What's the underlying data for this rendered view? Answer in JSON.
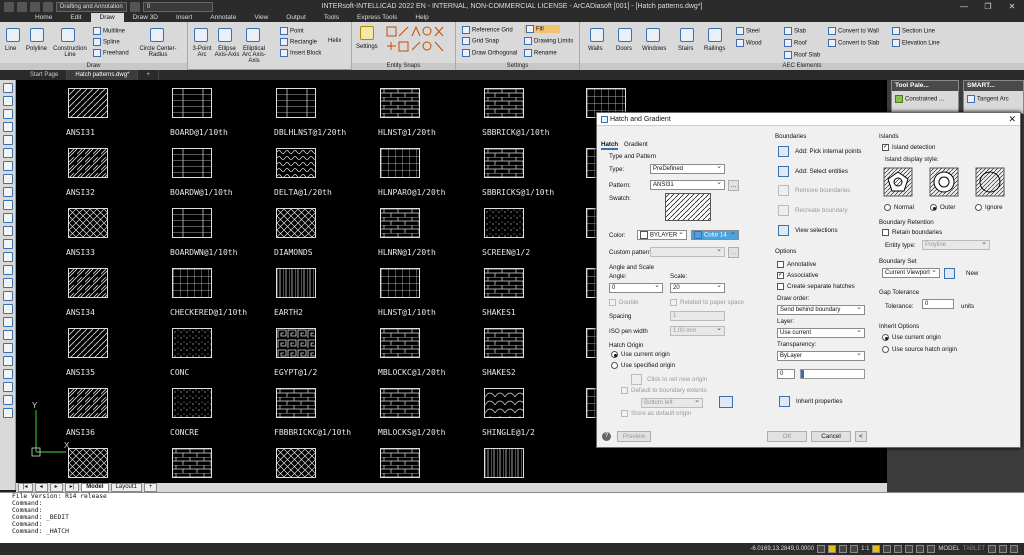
{
  "window": {
    "title": "INTERsoft-INTELLICAD 2022 EN - INTERNAL, NON-COMMERCIAL LICENSE - ArCADiasoft [001] - [Hatch patterns.dwg*]",
    "workspace": "Drafting and Annotation",
    "layer": "0",
    "controls": [
      "—",
      "❐",
      "✕"
    ]
  },
  "menu": [
    "Home",
    "Edit",
    "Draw",
    "Draw 3D",
    "Insert",
    "Annotate",
    "View",
    "Output",
    "Tools",
    "Express Tools",
    "Help"
  ],
  "menu_active": "Draw",
  "ribbon": {
    "draw": {
      "label": "Draw",
      "items": [
        "Line",
        "Polyline",
        "Construction Line",
        "Multiline",
        "Spline",
        "Freehand",
        "Circle Center-Radius",
        "3-Point Arc",
        "Ellipse Axis-Axis",
        "Elliptical Arc Axis-Axis",
        "Point",
        "Rectangle",
        "Helix",
        "Insert Block"
      ]
    },
    "snaps": {
      "label": "Entity Snaps",
      "items": [
        "Settings"
      ]
    },
    "settings": {
      "label": "Settings",
      "items": [
        "Reference Grid",
        "Grid Snap",
        "Draw Orthogonal",
        "Fill",
        "Drawing Limits",
        "Rename"
      ]
    },
    "aec": {
      "label": "AEC Elements",
      "items": [
        "Walls",
        "Doors",
        "Windows",
        "Stairs",
        "Railings",
        "Steel",
        "Wood",
        "Slab",
        "Roof",
        "Roof Slab",
        "Convert to Wall",
        "Convert to Slab",
        "Section Line",
        "Elevation Line"
      ]
    }
  },
  "doc_tabs": [
    "Start Page",
    "Hatch patterns.dwg*",
    "+"
  ],
  "hatch_labels": [
    [
      "ANSI31",
      "BOARD@1/10th",
      "DBLHLNST@1/20th",
      "HLNST@1/20th",
      "SBBRICK@1/10th"
    ],
    [
      "ANSI32",
      "BOARDW@1/10th",
      "DELTA@1/20th",
      "HLNPARO@1/20th",
      "SBBRICKS@1/10th"
    ],
    [
      "ANSI33",
      "BOARDWN@1/10th",
      "DIAMONDS",
      "HLNRN@1/20th",
      "SCREEN@1/2"
    ],
    [
      "ANSI34",
      "CHECKERED@1/10th",
      "EARTH2",
      "HLNST@1/10th",
      "SHAKES1"
    ],
    [
      "ANSI35",
      "CONC",
      "EGYPT@1/2",
      "MBLOCKC@1/20th",
      "SHAKES2"
    ],
    [
      "ANSI36",
      "CONCRE",
      "FBBBRICKC@1/10th",
      "MBLOCKS@1/20th",
      "SHINGLE@1/2"
    ]
  ],
  "model_tabs": [
    "Model",
    "Layout1",
    "+"
  ],
  "palettes": [
    {
      "title": "Tool Pale...",
      "item": "Constrained ..."
    },
    {
      "title": "SMART...",
      "item": "Tangent Arc"
    }
  ],
  "dialog": {
    "title": "Hatch and Gradient",
    "tabs": [
      "Hatch",
      "Gradient"
    ],
    "type_and_pattern": {
      "heading": "Type and Pattern",
      "type_label": "Type:",
      "type_value": "PreDefined",
      "pattern_label": "Pattern:",
      "pattern_value": "ANSI31",
      "swatch_label": "Swatch:",
      "color_label": "Color:",
      "color_value": "BYLAYER",
      "color2_value": "Color 14",
      "custom_label": "Custom pattern:"
    },
    "angle_and_scale": {
      "heading": "Angle and Scale",
      "angle_label": "Angle:",
      "angle_value": "0",
      "scale_label": "Scale:",
      "scale_value": "20",
      "double_label": "Double",
      "relative_label": "Related to paper space",
      "spacing_label": "Spacing",
      "spacing_value": "1",
      "iso_label": "ISO pen width",
      "iso_value": "1.00 mm"
    },
    "hatch_origin": {
      "heading": "Hatch Origin",
      "current": "Use current origin",
      "specified": "Use specified origin",
      "click_set": "Click to set new origin",
      "default_ext": "Default to boundary extents",
      "position": "Bottom left",
      "store": "Store as default origin"
    },
    "boundaries": {
      "heading": "Boundaries",
      "add_pick": "Add: Pick internal points",
      "add_select": "Add: Select entities",
      "remove": "Remove boundaries",
      "recreate": "Recreate boundary",
      "view": "View selections"
    },
    "options": {
      "heading": "Options",
      "annotative": "Annotative",
      "associative": "Associative",
      "separate": "Create separate hatches",
      "draw_order_label": "Draw order:",
      "draw_order_value": "Send behind boundary",
      "layer_label": "Layer:",
      "layer_value": "Use current",
      "transparency_label": "Transparency:",
      "transparency_value": "ByLayer",
      "transparency_amount": "0",
      "inherit": "Inherit properties"
    },
    "islands": {
      "heading": "Islands",
      "detection": "Island detection",
      "style_label": "Island display style:",
      "styles": [
        "Normal",
        "Outer",
        "Ignore"
      ],
      "selected": "Outer"
    },
    "boundary_retention": {
      "heading": "Boundary Retention",
      "retain": "Retain boundaries",
      "entity_type_label": "Entity type:",
      "entity_type_value": "Polyline"
    },
    "boundary_set": {
      "heading": "Boundary Set",
      "value": "Current Viewport",
      "new": "New"
    },
    "gap_tolerance": {
      "heading": "Gap Tolerance",
      "label": "Tolerance:",
      "value": "0",
      "units": "units"
    },
    "inherit_options": {
      "heading": "Inherit Options",
      "current": "Use current origin",
      "source": "Use source hatch origin"
    },
    "buttons": {
      "preview": "Preview",
      "ok": "OK",
      "cancel": "Cancel",
      "collapse": "<"
    }
  },
  "command_lines": [
    "File Version: R14 release",
    "Command:",
    "Command:",
    "Command: _BEDIT",
    "Command:",
    "Command: _HATCH"
  ],
  "status": {
    "coords": "-6.0169,13.2849,0.0000",
    "scale": "1:1",
    "mode": "MODEL",
    "tablet": "TABLET"
  }
}
